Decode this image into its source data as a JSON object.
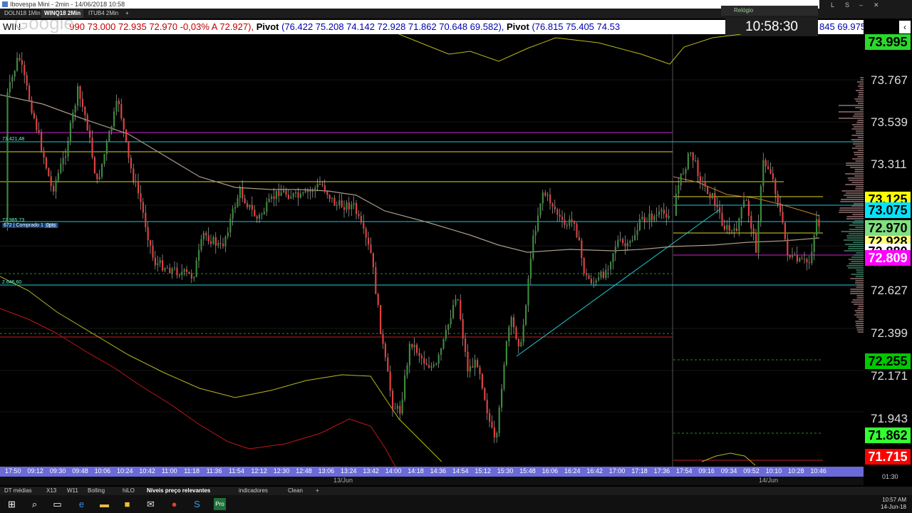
{
  "window": {
    "title": "Ibovespa Mini - 2min - 14/06/2018 10:58",
    "controls": [
      "L",
      "S",
      "–",
      "✕"
    ]
  },
  "tabs": [
    {
      "label": "DOLN18 1Min",
      "active": false
    },
    {
      "label": "WINQ18 2Min",
      "active": true
    },
    {
      "label": "ITUB4 2Min",
      "active": false
    },
    {
      "label": "+",
      "active": false
    }
  ],
  "ticker": {
    "prefix": "WIN",
    "google_overlay": "Google",
    "prices": "990  73.000  72.935  72.970  -0,03%  A 72.927),",
    "pivot1_label": "Pivot",
    "pivot1_values": "(76.422  75.208  74.142  72.928  71.862  70.648  69.582),",
    "pivot2_label": "Pivot",
    "pivot2_values": "(76.815  75.405  74.53",
    "tail": "845  69.975),  P"
  },
  "clock": {
    "title": "Relógio",
    "time": "10:58:30"
  },
  "chart": {
    "position_box": "672 | Comprado 1",
    "position_pts": "0pts",
    "left_values": [
      "73.421,48",
      "72.985,73",
      "2.646,60"
    ],
    "background": "#000000",
    "up_color": "#3a8a3a",
    "down_color": "#e04040"
  },
  "y_axis": {
    "labels": [
      "73.767",
      "73.539",
      "73.311",
      "72.627",
      "72.399",
      "72.171",
      "71.943"
    ],
    "tags": [
      {
        "text": "73.995",
        "bg": "#2bd92b",
        "fg": "#000000"
      },
      {
        "text": "73.125",
        "bg": "#ffff00",
        "fg": "#000000"
      },
      {
        "text": "73.075",
        "bg": "#00e5ff",
        "fg": "#000000"
      },
      {
        "text": "72.970",
        "bg": "#7fe07f",
        "fg": "#000000"
      },
      {
        "text": "72.928",
        "bg": "#ffff80",
        "fg": "#000000"
      },
      {
        "text": "72.880",
        "bg": "#ffffff",
        "fg": "#000000"
      },
      {
        "text": "72.809",
        "bg": "#ff00ff",
        "fg": "#ffffff"
      },
      {
        "text": "72.255",
        "bg": "#00c800",
        "fg": "#000000"
      },
      {
        "text": "71.862",
        "bg": "#33ff33",
        "fg": "#000000"
      },
      {
        "text": "71.715",
        "bg": "#ff0000",
        "fg": "#ffffff"
      }
    ]
  },
  "x_axis": {
    "ticks": [
      "17:50",
      "09:12",
      "09:30",
      "09:48",
      "10:06",
      "10:24",
      "10:42",
      "11:00",
      "11:18",
      "11:36",
      "11:54",
      "12:12",
      "12:30",
      "12:48",
      "13:06",
      "13:24",
      "13:42",
      "14:00",
      "14:18",
      "14:36",
      "14:54",
      "15:12",
      "15:30",
      "15:48",
      "16:06",
      "16:24",
      "16:42",
      "17:00",
      "17:18",
      "17:36",
      "17:54",
      "09:16",
      "09:34",
      "09:52",
      "10:10",
      "10:28",
      "10:46"
    ],
    "dates": [
      "13/Jun",
      "14/Jun"
    ],
    "timer": "01:30"
  },
  "bottom_tabs": [
    {
      "label": "DT médias",
      "active": false
    },
    {
      "label": "X13",
      "active": false
    },
    {
      "label": "W11",
      "active": false
    },
    {
      "label": "Bolling",
      "active": false
    },
    {
      "label": "hiLO",
      "active": false
    },
    {
      "label": "Níveis preço relevantes",
      "active": true
    },
    {
      "label": "indicadores",
      "active": false
    },
    {
      "label": "Clean",
      "active": false
    },
    {
      "label": "+",
      "active": false
    }
  ],
  "taskbar": {
    "icons": [
      "windows-icon",
      "search-icon",
      "task-view-icon",
      "edge-icon",
      "folder-icon",
      "store-icon",
      "mail-icon",
      "chrome-icon",
      "skype-icon",
      "profit-pro-icon"
    ],
    "pro_label": "Pro",
    "time": "10:57 AM",
    "date": "14-Jun-18"
  }
}
